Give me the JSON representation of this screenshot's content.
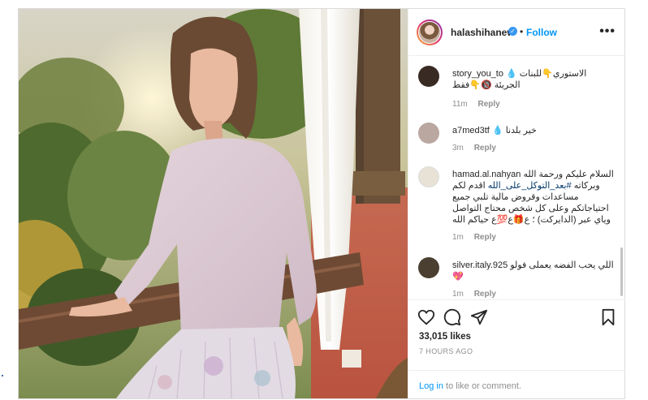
{
  "header": {
    "username": "halashihanew",
    "follow_label": "Follow",
    "dot": "•",
    "more_label": "•••",
    "verified_mark": "✓"
  },
  "comments": [
    {
      "user": "story_you_to",
      "text": "الاستوري👇للبنات 💧 الجريئة 🔞👇فقط",
      "time": "11m",
      "reply": "Reply",
      "avatar_color": "#3a2a24"
    },
    {
      "user": "a7med3tf",
      "text": "خير بلدنا 💧",
      "time": "3m",
      "reply": "Reply",
      "avatar_color": "#b9a7a0"
    },
    {
      "user": "hamad.al.nahyan",
      "text_before": "السلام عليكم ورحمة الله وبركاته ",
      "hashtag": "#بعد_التوكل_على_الله",
      "text_after": " اقدم لكم مساعدات وقروض مالية تلبي جميع احتياجاتكم وعلى كل شخص محتاج التواصل وياي عبر (الدايركت) ؛ ع🎁ع💯ع حياكم الله",
      "time": "1m",
      "reply": "Reply",
      "avatar_color": "#e8e2d6"
    },
    {
      "user": "silver.italy.925",
      "text": "اللي يحب الفضه يعملى فولو 💖",
      "time": "1m",
      "reply": "Reply",
      "avatar_color": "#4a3f30"
    }
  ],
  "actions": {
    "likes": "33,015 likes",
    "time": "7 HOURS AGO",
    "login_link": "Log in",
    "login_rest": " to like or comment."
  },
  "colors": {
    "link": "#0095f6",
    "muted": "#8e8e8e",
    "border": "#dbdbdb",
    "text": "#262626"
  }
}
